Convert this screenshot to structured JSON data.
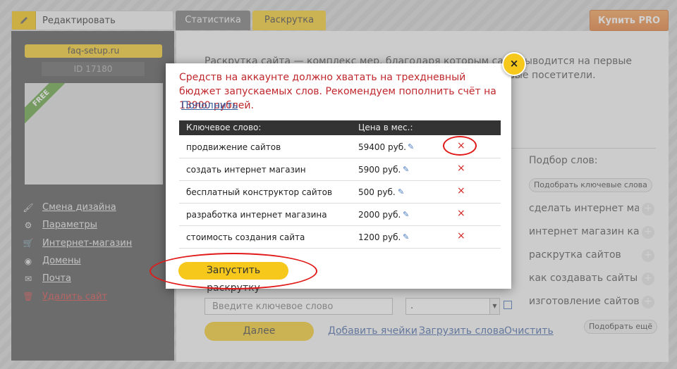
{
  "topbar": {
    "edit_label": "Редактировать",
    "tabs": [
      {
        "label": "Статистика",
        "active": false
      },
      {
        "label": "Раскрутка",
        "active": true
      }
    ],
    "buy_pro_label": "Купить PRO"
  },
  "sidebar": {
    "site_name": "faq-setup.ru",
    "site_id": "ID 17180",
    "badge": "FREE",
    "menu": [
      {
        "icon": "brush-icon",
        "label": "Смена дизайна"
      },
      {
        "icon": "gear-icon",
        "label": "Параметры"
      },
      {
        "icon": "cart-icon",
        "label": "Интернет-магазин"
      },
      {
        "icon": "globe-icon",
        "label": "Домены"
      },
      {
        "icon": "mail-icon",
        "label": "Почта"
      },
      {
        "icon": "trash-icon",
        "label": "Удалить сайт"
      }
    ]
  },
  "main": {
    "intro_text": "Раскрутка сайта — комплекс мер, благодаря которым сайт выводится на первые места в поисковых системах и начинает привлекать целевые посетители.",
    "word_picker_title": "Подбор слов:",
    "pick_keywords_label": "Подобрать ключевые слова",
    "suggestions": [
      "сделать интернет магазин",
      "интернет магазин как с",
      "раскрутка сайтов",
      "как создавать сайты",
      "изготовление сайтов"
    ],
    "pick_more_label": "Подобрать ещё",
    "keyword_placeholder": "Введите ключевое слово",
    "select_value": ".",
    "next_label": "Далее",
    "links": [
      "Добавить ячейки",
      "Загрузить слова",
      "Очистить"
    ]
  },
  "modal": {
    "warning": "Средств на аккаунте должно хватать на трехдневный бюджет запускаемых слов. Рекомендуем пополнить счёт на 13900 рублей.",
    "topup_label": "Пополнить",
    "col_keyword": "Ключевое слово:",
    "col_price": "Цена в мес.:",
    "rows": [
      {
        "keyword": "продвижение сайтов",
        "price": "59400 руб."
      },
      {
        "keyword": "создать интернет магазин",
        "price": "5900 руб."
      },
      {
        "keyword": "бесплатный конструктор сайтов",
        "price": "500 руб."
      },
      {
        "keyword": "разработка интернет магазина",
        "price": "2000 руб."
      },
      {
        "keyword": "стоимость создания сайта",
        "price": "1200 руб."
      }
    ],
    "launch_label": "Запустить раскрутку",
    "close_glyph": "×",
    "delete_glyph": "×",
    "edit_glyph": "✎"
  },
  "colors": {
    "accent": "#f6c81c",
    "danger": "#c0282d",
    "sidebar_bg": "#4a4a4a",
    "link": "#3a5fa0",
    "highlight_ring": "#e11a1a"
  }
}
